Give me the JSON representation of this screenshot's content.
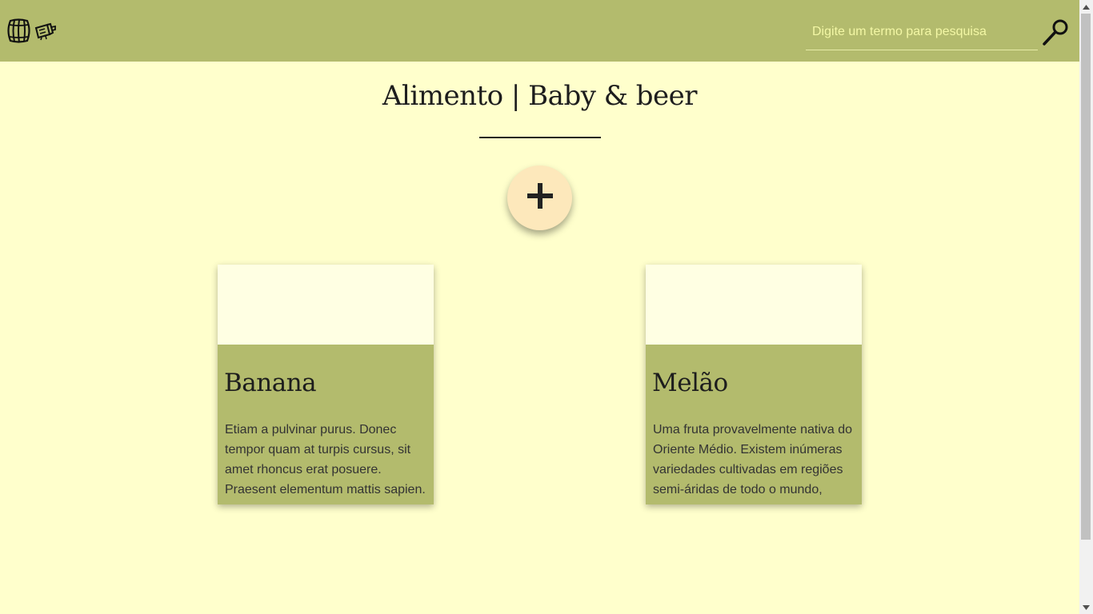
{
  "header": {
    "search": {
      "placeholder": "Digite um termo para pesquisa",
      "value": ""
    }
  },
  "main": {
    "title": "Alimento | Baby & beer",
    "add_button_symbol": "+"
  },
  "cards": [
    {
      "title": "Banana",
      "description": "Etiam a pulvinar purus. Donec tempor quam at turpis cursus, sit amet rhoncus erat posuere. Praesent elementum mattis sapien."
    },
    {
      "title": "Melão",
      "description": "Uma fruta provavelmente nativa do Oriente Médio. Existem inúmeras variedades cultivadas em regiões semi-áridas de todo o mundo,"
    }
  ],
  "icons": {
    "logo_left": "barrel-icon",
    "logo_right": "baby-bottle-icon",
    "search": "magnifier-icon",
    "add": "plus-icon"
  },
  "colors": {
    "header_bg": "#b3bb6d",
    "page_bg": "#ffffcc",
    "card_image_bg": "#ffffe3",
    "fab_bg": "#fde8bb"
  }
}
